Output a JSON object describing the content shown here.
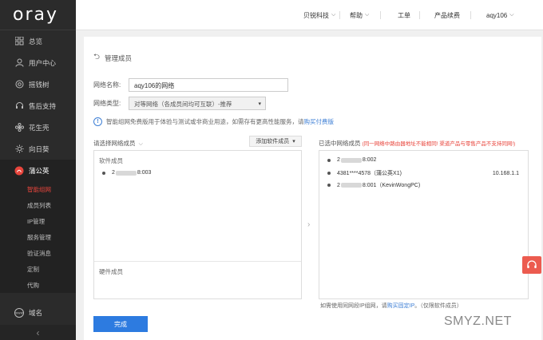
{
  "logo": "oray",
  "sidebar": {
    "items": [
      {
        "label": "总览",
        "icon": "grid-icon"
      },
      {
        "label": "用户中心",
        "icon": "user-icon"
      },
      {
        "label": "摇钱树",
        "icon": "circle-icon"
      },
      {
        "label": "售后支持",
        "icon": "headset-icon"
      },
      {
        "label": "花生壳",
        "icon": "flower-icon"
      },
      {
        "label": "向日葵",
        "icon": "sun-icon"
      },
      {
        "label": "蒲公英",
        "icon": "dandelion-icon"
      }
    ],
    "sub_items": [
      "智能组网",
      "成员列表",
      "IP管理",
      "服务管理",
      "验证消息",
      "定制",
      "代购"
    ],
    "bottom_item": "域名",
    "collapse": "‹"
  },
  "topbar": {
    "menus": [
      "贝锐科技",
      "帮助",
      "工单",
      "产品续费",
      "aqy106"
    ]
  },
  "page": {
    "back_title": "管理成员",
    "network_name_label": "网络名称:",
    "network_name_value": "aqy106的网络",
    "network_type_label": "网络类型:",
    "network_type_value": "对等网络（各成员间均可互联）-推荐",
    "notice_text": "智能组网免费版用于体验与测试或非商业用途，如需存有更高性能服务，请",
    "notice_link": "购买付费版",
    "left_pane_title": "请选择网络成员",
    "add_member_button": "添加软件成员",
    "left_software_section": "软件成员",
    "left_software_members": [
      {
        "prefix": "2",
        "suffix": "8:003"
      }
    ],
    "left_hardware_section": "硬件成员",
    "right_pane_title": "已选中网络成员",
    "right_pane_warning": "(同一网络中路由器地址不能相同! 渠道产品与零售产品不支持同网!)",
    "right_members": [
      {
        "prefix": "2",
        "suffix": "8:002",
        "ip": ""
      },
      {
        "prefix": "4381****4578（蒲公英X1)",
        "suffix": "",
        "ip": "10.168.1.1"
      },
      {
        "prefix": "2",
        "suffix": "8:001（KevinWongPC)",
        "ip": ""
      }
    ],
    "hint_text": "如需使用同网段IP组网，请",
    "hint_link": "购买固定IP",
    "hint_tail": "。（仅限软件成员）",
    "done_button": "完成"
  },
  "watermark": "SMYZ.NET",
  "colors": {
    "accent": "#2d7be0",
    "sidebar_bg": "#2b2b2b",
    "warning": "#e8453c",
    "support_bg": "#ec5b4f"
  }
}
